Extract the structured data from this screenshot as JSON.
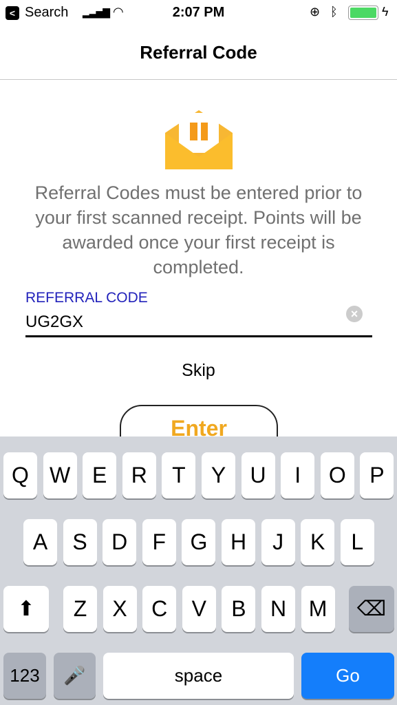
{
  "status": {
    "back_app": "Search",
    "time": "2:07 PM",
    "battery_color": "#4cd964"
  },
  "nav": {
    "title": "Referral Code"
  },
  "icon": "gift-envelope-icon",
  "message": "Referral Codes must be entered prior to your first scanned receipt. Points will be awarded once your first receipt is completed.",
  "field": {
    "label": "REFERRAL CODE",
    "value": "UG2GX"
  },
  "skip_label": "Skip",
  "enter_label": "Enter",
  "keyboard": {
    "row1": [
      "Q",
      "W",
      "E",
      "R",
      "T",
      "Y",
      "U",
      "I",
      "O",
      "P"
    ],
    "row2": [
      "A",
      "S",
      "D",
      "F",
      "G",
      "H",
      "J",
      "K",
      "L"
    ],
    "row3": [
      "Z",
      "X",
      "C",
      "V",
      "B",
      "N",
      "M"
    ],
    "numbers": "123",
    "space": "space",
    "go": "Go",
    "go_color": "#147efb"
  }
}
